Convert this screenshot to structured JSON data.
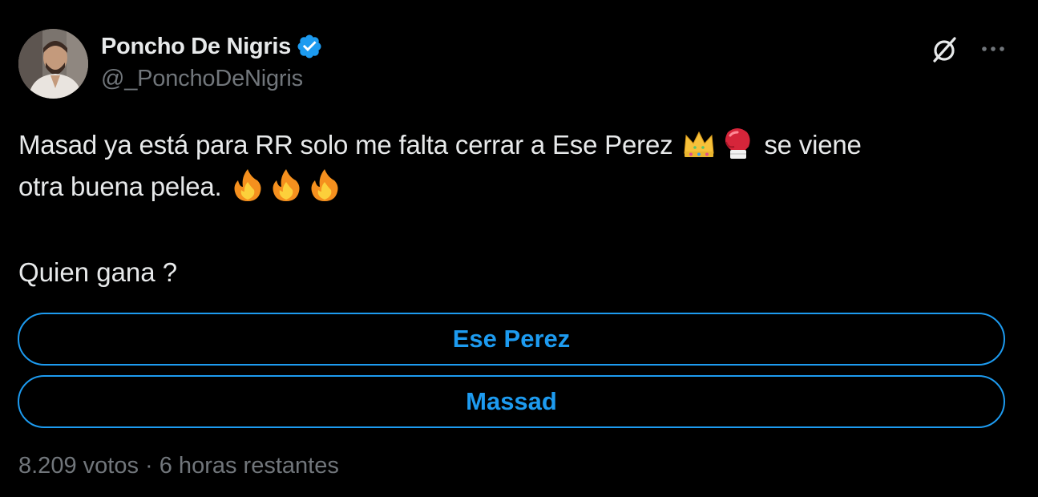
{
  "author": {
    "name": "Poncho De Nigris",
    "handle": "@_PonchoDeNigris",
    "verified": true
  },
  "header_icons": [
    "grok-icon",
    "more-icon"
  ],
  "tweet": {
    "line1_text": "Masad ya está para RR solo me falta cerrar a Ese Perez",
    "line1_emojis": [
      "crown-emoji",
      "boxing-glove-emoji"
    ],
    "line1_after": "se viene",
    "line2_text": "otra buena pelea.",
    "line2_emojis": [
      "fire-emoji",
      "fire-emoji",
      "fire-emoji"
    ],
    "question": "Quien gana ?"
  },
  "poll": {
    "options": [
      {
        "label": "Ese Perez"
      },
      {
        "label": "Massad"
      }
    ],
    "votes": "8.209 votos",
    "separator": "·",
    "time_left": "6 horas restantes"
  },
  "colors": {
    "background": "#000000",
    "text_primary": "#e7e9ea",
    "text_secondary": "#71767b",
    "accent": "#1d9bf0"
  }
}
